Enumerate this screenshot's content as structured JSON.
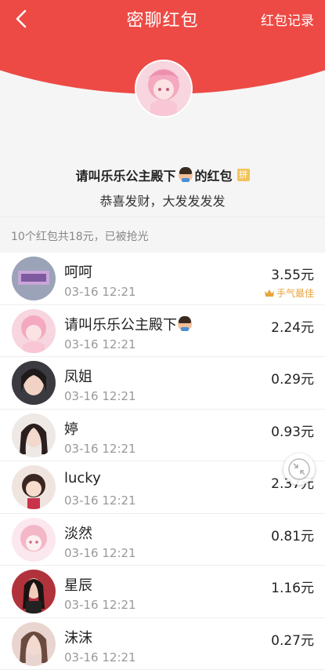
{
  "header": {
    "title": "密聊红包",
    "record_label": "红包记录",
    "background_color": "#ed4a45"
  },
  "packet": {
    "sender_prefix": "请叫乐乐公主殿下",
    "sender_suffix": "的红包",
    "pin_badge": "拼",
    "blessing": "恭喜发财，大发发发发",
    "summary": "10个红包共18元，已被抢光"
  },
  "recipients": [
    {
      "name": "呵呵",
      "time": "03-16 12:21",
      "amount": "3.55元",
      "best": "手气最佳"
    },
    {
      "name": "请叫乐乐公主殿下",
      "time": "03-16 12:21",
      "amount": "2.24元"
    },
    {
      "name": "凤姐",
      "time": "03-16 12:21",
      "amount": "0.29元"
    },
    {
      "name": "婷",
      "time": "03-16 12:21",
      "amount": "0.93元"
    },
    {
      "name": "lucky",
      "time": "03-16 12:21",
      "amount": "2.37元"
    },
    {
      "name": "淡然",
      "time": "03-16 12:21",
      "amount": "0.81元"
    },
    {
      "name": "星辰",
      "time": "03-16 12:21",
      "amount": "1.16元"
    },
    {
      "name": "沫沫",
      "time": "03-16 12:21",
      "amount": "0.27元"
    }
  ],
  "icons": {
    "back": "back-arrow-icon",
    "crown": "crown-icon",
    "float": "collapse-arrows-icon"
  }
}
